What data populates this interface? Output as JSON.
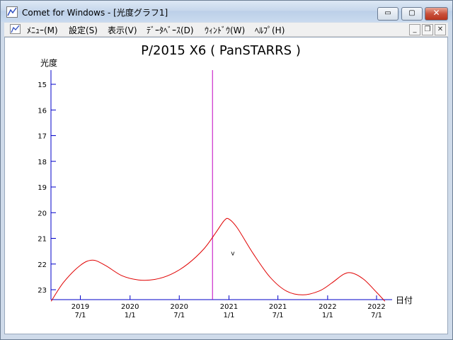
{
  "window": {
    "title": "Comet for Windows - [光度グラフ1]",
    "controls": {
      "minimize": "▭",
      "maximize": "▢",
      "close": "✕"
    }
  },
  "menubar": {
    "items": [
      "ﾒﾆｭｰ(M)",
      "設定(S)",
      "表示(V)",
      "ﾃﾞｰﾀﾍﾞｰｽ(D)",
      "ｳｨﾝﾄﾞｳ(W)",
      "ﾍﾙﾌﾟ(H)"
    ],
    "mdi_controls": {
      "minimize": "_",
      "restore": "❐",
      "close": "✕"
    }
  },
  "colors": {
    "axis": "#0000c8",
    "curve": "#e00000",
    "marker": "#c000c0",
    "text": "#000000"
  },
  "chart_data": {
    "type": "line",
    "title": "P/2015 X6 ( PanSTARRS )",
    "ylabel": "光度",
    "xlabel": "日付",
    "ylim": [
      15,
      23
    ],
    "y_inverted": true,
    "y_ticks": [
      "15",
      "16",
      "17",
      "18",
      "19",
      "20",
      "21",
      "22",
      "23"
    ],
    "x_ticks": [
      {
        "year": "2019",
        "day": "7/1"
      },
      {
        "year": "2020",
        "day": "1/1"
      },
      {
        "year": "2020",
        "day": "7/1"
      },
      {
        "year": "2021",
        "day": "1/1"
      },
      {
        "year": "2021",
        "day": "7/1"
      },
      {
        "year": "2022",
        "day": "1/1"
      },
      {
        "year": "2022",
        "day": "7/1"
      }
    ],
    "series": [
      {
        "points": [
          [
            "2019-03-15",
            23.45
          ],
          [
            "2019-05-01",
            22.7
          ],
          [
            "2019-07-01",
            22.05
          ],
          [
            "2019-08-15",
            21.85
          ],
          [
            "2019-10-01",
            22.05
          ],
          [
            "2019-12-01",
            22.45
          ],
          [
            "2020-02-01",
            22.62
          ],
          [
            "2020-04-01",
            22.6
          ],
          [
            "2020-06-01",
            22.4
          ],
          [
            "2020-08-01",
            22.0
          ],
          [
            "2020-10-01",
            21.4
          ],
          [
            "2020-11-15",
            20.75
          ],
          [
            "2020-12-15",
            20.3
          ],
          [
            "2021-01-01",
            20.25
          ],
          [
            "2021-02-01",
            20.6
          ],
          [
            "2021-04-01",
            21.6
          ],
          [
            "2021-06-01",
            22.5
          ],
          [
            "2021-08-01",
            23.05
          ],
          [
            "2021-10-01",
            23.2
          ],
          [
            "2021-12-01",
            23.05
          ],
          [
            "2022-01-15",
            22.75
          ],
          [
            "2022-03-01",
            22.4
          ],
          [
            "2022-04-01",
            22.35
          ],
          [
            "2022-05-15",
            22.6
          ],
          [
            "2022-07-01",
            23.1
          ],
          [
            "2022-08-01",
            23.45
          ]
        ]
      }
    ],
    "current_date": "2020-11-01",
    "annotation": {
      "text": "v",
      "date": "2021-01-15",
      "magnitude": 21.55
    }
  }
}
